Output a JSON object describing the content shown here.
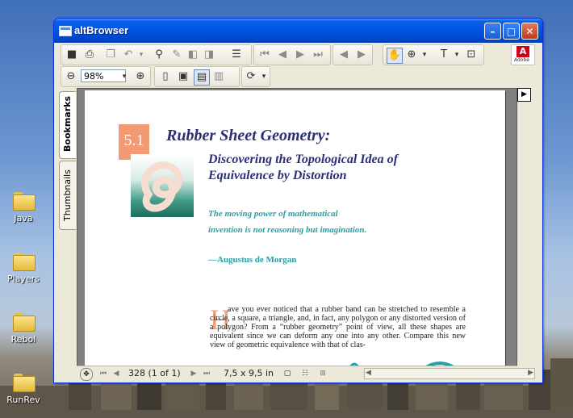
{
  "desktop": {
    "icons": [
      {
        "label": "Java"
      },
      {
        "label": "Players"
      },
      {
        "label": "Rebol"
      },
      {
        "label": "RunRev"
      }
    ]
  },
  "window": {
    "title": "altBrowser",
    "controls": {
      "minimize": "–",
      "maximize": "□",
      "close": "✕"
    }
  },
  "toolbar": {
    "zoom_value": "98%",
    "adobe_label": "Adobe"
  },
  "sidebar": {
    "tabs": [
      {
        "label": "Bookmarks"
      },
      {
        "label": "Thumbnails"
      }
    ]
  },
  "document": {
    "section_number": "5.1",
    "title": "Rubber Sheet Geometry:",
    "subtitle": "Discovering the Topological Idea of Equivalence by Distortion",
    "quote": "The moving power of mathematical invention is not reasoning but imagination.",
    "quote_author": "—Augustus de Morgan",
    "drop_cap": "H",
    "body": "ave you ever noticed that a rubber band can be stretched to resemble a circle, a square, a triangle, and, in fact, any polygon or any distorted version of a polygon? From a “rubber geometry” point of view, all these shapes are equivalent since we can deform any one into any other. Compare this new view of geometric equivalence with that of clas-"
  },
  "statusbar": {
    "page_indicator": "328  (1 of 1)",
    "page_size": "7,5 x 9,5 in"
  }
}
